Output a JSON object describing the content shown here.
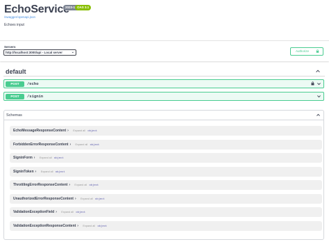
{
  "header": {
    "title": "EchoService",
    "version_badge": "2023-12-03",
    "oas_badge": "OAS 3.1",
    "spec_link": "/swagger/openapi.json",
    "description": "Echoes input"
  },
  "servers": {
    "label": "Servers",
    "selected": "http://localhost:3000/api - Local server"
  },
  "authorize": {
    "label": "Authorize"
  },
  "tag": {
    "name": "default"
  },
  "operations": [
    {
      "method": "POST",
      "path": "/echo",
      "locked": true
    },
    {
      "method": "POST",
      "path": "/signin",
      "locked": false
    }
  ],
  "schemas": {
    "title": "Schemas",
    "expand_label": "Expand all",
    "type_label": "object",
    "items": [
      "EchoMessageResponseContent",
      "ForbiddenErrorResponseContent",
      "SigninForm",
      "SigninToken",
      "ThrottlingErrorResponseContent",
      "UnauthorizedErrorResponseContent",
      "ValidationExceptionField",
      "ValidationExceptionResponseContent"
    ]
  },
  "colors": {
    "post_green": "#49cc90",
    "link_blue": "#4990e2",
    "text": "#3b4151"
  }
}
